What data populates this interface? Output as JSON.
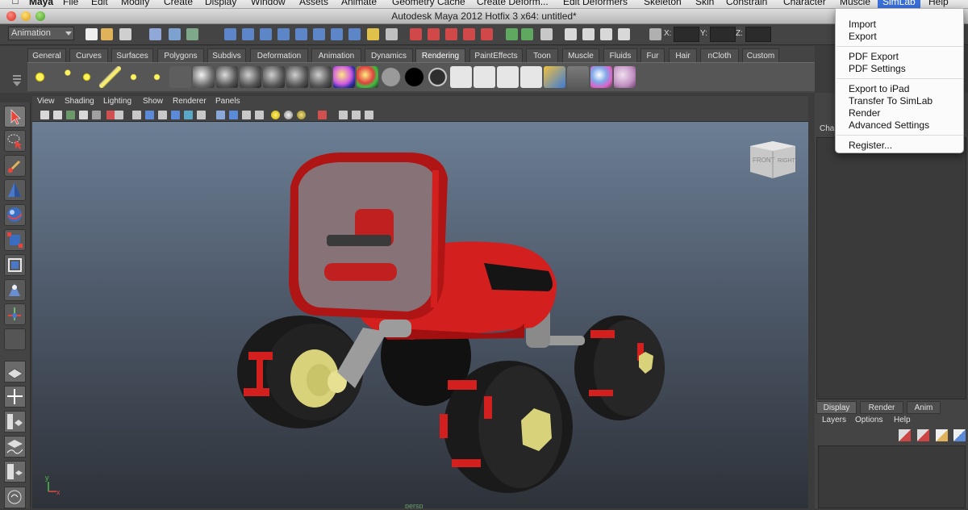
{
  "menubar": {
    "app": "Maya",
    "items": [
      "File",
      "Edit",
      "Modify",
      "Create",
      "Display",
      "Window",
      "Assets",
      "Animate",
      "Geometry Cache",
      "Create Deform...",
      "Edit Deformers",
      "Skeleton",
      "Skin",
      "Constrain",
      "Character",
      "Muscle",
      "SimLab",
      "Help"
    ],
    "active": "SimLab"
  },
  "window": {
    "title": "Autodesk Maya 2012 Hotfix 3 x64: untitled*"
  },
  "status_line": {
    "mode": "Animation",
    "x_label": "X:",
    "y_label": "Y:",
    "z_label": "Z:"
  },
  "shelf": {
    "tabs": [
      "General",
      "Curves",
      "Surfaces",
      "Polygons",
      "Subdivs",
      "Deformation",
      "Animation",
      "Dynamics",
      "Rendering",
      "PaintEffects",
      "Toon",
      "Muscle",
      "Fluids",
      "Fur",
      "Hair",
      "nCloth",
      "Custom"
    ],
    "active_tab": "Rendering"
  },
  "panel_menu": [
    "View",
    "Shading",
    "Lighting",
    "Show",
    "Renderer",
    "Panels"
  ],
  "viewport": {
    "camera": "persp",
    "viewcube_front": "FRONT",
    "viewcube_right": "RIGHT",
    "axis_x": "x",
    "axis_y": "y"
  },
  "channel_box": {
    "label": "Char"
  },
  "layer_editor": {
    "tabs": [
      "Display",
      "Render",
      "Anim"
    ],
    "active_tab": "Display",
    "menu": [
      "Layers",
      "Options",
      "Help"
    ]
  },
  "simlab_menu": {
    "groups": [
      [
        "Import",
        "Export"
      ],
      [
        "PDF Export",
        "PDF Settings"
      ],
      [
        "Export to iPad",
        "Transfer To SimLab",
        "Render",
        "Advanced Settings"
      ],
      [
        "Register..."
      ]
    ]
  },
  "colors": {
    "car_body": "#d41f1f",
    "tire": "#1a1a1a",
    "hub": "#d8d27a",
    "menu_highlight": "#3a6fd8"
  }
}
